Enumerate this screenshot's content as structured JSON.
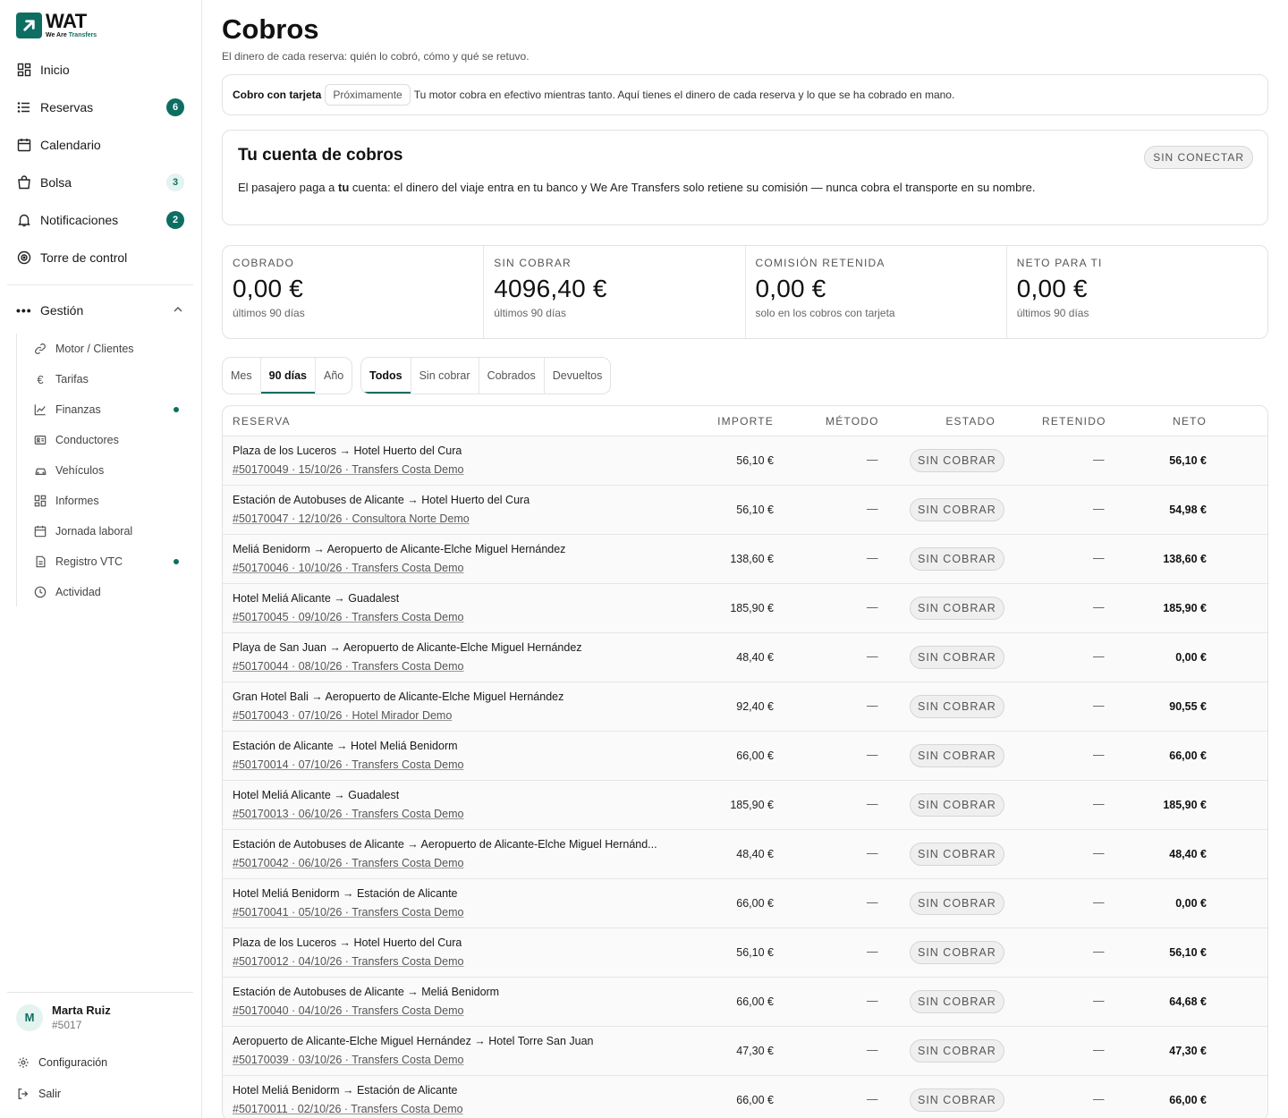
{
  "brand": {
    "name": "WAT",
    "tagline_a": "We Are ",
    "tagline_b": "Transfers"
  },
  "sidebar": {
    "nav": [
      {
        "label": "Inicio",
        "icon": "grid-icon"
      },
      {
        "label": "Reservas",
        "icon": "list-icon",
        "badge": "6"
      },
      {
        "label": "Calendario",
        "icon": "calendar-icon"
      },
      {
        "label": "Bolsa",
        "icon": "bag-icon",
        "badge": "3"
      },
      {
        "label": "Notificaciones",
        "icon": "bell-icon",
        "badge": "2"
      },
      {
        "label": "Torre de control",
        "icon": "target-icon"
      }
    ],
    "group_label": "Gestión",
    "sub": [
      {
        "label": "Motor / Clientes",
        "icon": "link-icon"
      },
      {
        "label": "Tarifas",
        "icon": "euro-icon"
      },
      {
        "label": "Finanzas",
        "icon": "chart-line-icon",
        "dot": true
      },
      {
        "label": "Conductores",
        "icon": "id-card-icon"
      },
      {
        "label": "Vehículos",
        "icon": "car-icon"
      },
      {
        "label": "Informes",
        "icon": "grid-icon"
      },
      {
        "label": "Jornada laboral",
        "icon": "calendar-icon"
      },
      {
        "label": "Registro VTC",
        "icon": "document-icon",
        "dot": true
      },
      {
        "label": "Actividad",
        "icon": "clock-icon"
      }
    ],
    "user": {
      "initial": "M",
      "name": "Marta Ruiz",
      "id": "#5017"
    },
    "settings_label": "Configuración",
    "logout_label": "Salir"
  },
  "page": {
    "title": "Cobros",
    "subtitle": "El dinero de cada reserva: quién lo cobró, cómo y qué se retuvo."
  },
  "notice": {
    "label": "Cobro con tarjeta",
    "chip": "Próximamente",
    "text": "Tu motor cobra en efectivo mientras tanto. Aquí tienes el dinero de cada reserva y lo que se ha cobrado en mano."
  },
  "account": {
    "title": "Tu cuenta de cobros",
    "status": "SIN CONECTAR",
    "desc_a": "El pasajero paga a ",
    "desc_b": "tu",
    "desc_c": " cuenta: el dinero del viaje entra en tu banco y We Are Transfers solo retiene su comisión — nunca cobra el transporte en su nombre."
  },
  "stats": [
    {
      "label": "COBRADO",
      "value": "0,00 €",
      "note": "últimos 90 días"
    },
    {
      "label": "SIN COBRAR",
      "value": "4096,40 €",
      "note": "últimos 90 días"
    },
    {
      "label": "COMISIÓN RETENIDA",
      "value": "0,00 €",
      "note": "solo en los cobros con tarjeta"
    },
    {
      "label": "NETO PARA TI",
      "value": "0,00 €",
      "note": "últimos 90 días"
    }
  ],
  "period_tabs": [
    "Mes",
    "90 días",
    "Año"
  ],
  "status_tabs": [
    "Todos",
    "Sin cobrar",
    "Cobrados",
    "Devueltos"
  ],
  "table": {
    "headers": {
      "reserva": "RESERVA",
      "importe": "IMPORTE",
      "metodo": "MÉTODO",
      "estado": "ESTADO",
      "retenido": "RETENIDO",
      "neto": "NETO"
    },
    "dash": "—",
    "rows": [
      {
        "route": "Plaza de los Luceros → Hotel Huerto del Cura",
        "ref": "#50170049 · 15/10/26 · Transfers Costa Demo",
        "importe": "56,10 €",
        "estado": "SIN COBRAR",
        "neto": "56,10 €"
      },
      {
        "route": "Estación de Autobuses de Alicante → Hotel Huerto del Cura",
        "ref": "#50170047 · 12/10/26 · Consultora Norte Demo",
        "importe": "56,10 €",
        "estado": "SIN COBRAR",
        "neto": "54,98 €"
      },
      {
        "route": "Meliá Benidorm → Aeropuerto de Alicante-Elche Miguel Hernández",
        "ref": "#50170046 · 10/10/26 · Transfers Costa Demo",
        "importe": "138,60 €",
        "estado": "SIN COBRAR",
        "neto": "138,60 €"
      },
      {
        "route": "Hotel Meliá Alicante → Guadalest",
        "ref": "#50170045 · 09/10/26 · Transfers Costa Demo",
        "importe": "185,90 €",
        "estado": "SIN COBRAR",
        "neto": "185,90 €"
      },
      {
        "route": "Playa de San Juan → Aeropuerto de Alicante-Elche Miguel Hernández",
        "ref": "#50170044 · 08/10/26 · Transfers Costa Demo",
        "importe": "48,40 €",
        "estado": "SIN COBRAR",
        "neto": "0,00 €"
      },
      {
        "route": "Gran Hotel Bali → Aeropuerto de Alicante-Elche Miguel Hernández",
        "ref": "#50170043 · 07/10/26 · Hotel Mirador Demo",
        "importe": "92,40 €",
        "estado": "SIN COBRAR",
        "neto": "90,55 €"
      },
      {
        "route": "Estación de Alicante → Hotel Meliá Benidorm",
        "ref": "#50170014 · 07/10/26 · Transfers Costa Demo",
        "importe": "66,00 €",
        "estado": "SIN COBRAR",
        "neto": "66,00 €"
      },
      {
        "route": "Hotel Meliá Alicante → Guadalest",
        "ref": "#50170013 · 06/10/26 · Transfers Costa Demo",
        "importe": "185,90 €",
        "estado": "SIN COBRAR",
        "neto": "185,90 €"
      },
      {
        "route": "Estación de Autobuses de Alicante → Aeropuerto de Alicante-Elche Miguel Hernánd...",
        "ref": "#50170042 · 06/10/26 · Transfers Costa Demo",
        "importe": "48,40 €",
        "estado": "SIN COBRAR",
        "neto": "48,40 €"
      },
      {
        "route": "Hotel Meliá Benidorm → Estación de Alicante",
        "ref": "#50170041 · 05/10/26 · Transfers Costa Demo",
        "importe": "66,00 €",
        "estado": "SIN COBRAR",
        "neto": "0,00 €"
      },
      {
        "route": "Plaza de los Luceros → Hotel Huerto del Cura",
        "ref": "#50170012 · 04/10/26 · Transfers Costa Demo",
        "importe": "56,10 €",
        "estado": "SIN COBRAR",
        "neto": "56,10 €"
      },
      {
        "route": "Estación de Autobuses de Alicante → Meliá Benidorm",
        "ref": "#50170040 · 04/10/26 · Transfers Costa Demo",
        "importe": "66,00 €",
        "estado": "SIN COBRAR",
        "neto": "64,68 €"
      },
      {
        "route": "Aeropuerto de Alicante-Elche Miguel Hernández → Hotel Torre San Juan",
        "ref": "#50170039 · 03/10/26 · Transfers Costa Demo",
        "importe": "47,30 €",
        "estado": "SIN COBRAR",
        "neto": "47,30 €"
      },
      {
        "route": "Hotel Meliá Benidorm → Estación de Alicante",
        "ref": "#50170011 · 02/10/26 · Transfers Costa Demo",
        "importe": "66,00 €",
        "estado": "SIN COBRAR",
        "neto": "66,00 €"
      }
    ]
  },
  "colors": {
    "accent": "#0e6e62",
    "badge_light": "#e3f3ef",
    "pill_bg": "#efefef",
    "border": "#e2e2e2"
  }
}
